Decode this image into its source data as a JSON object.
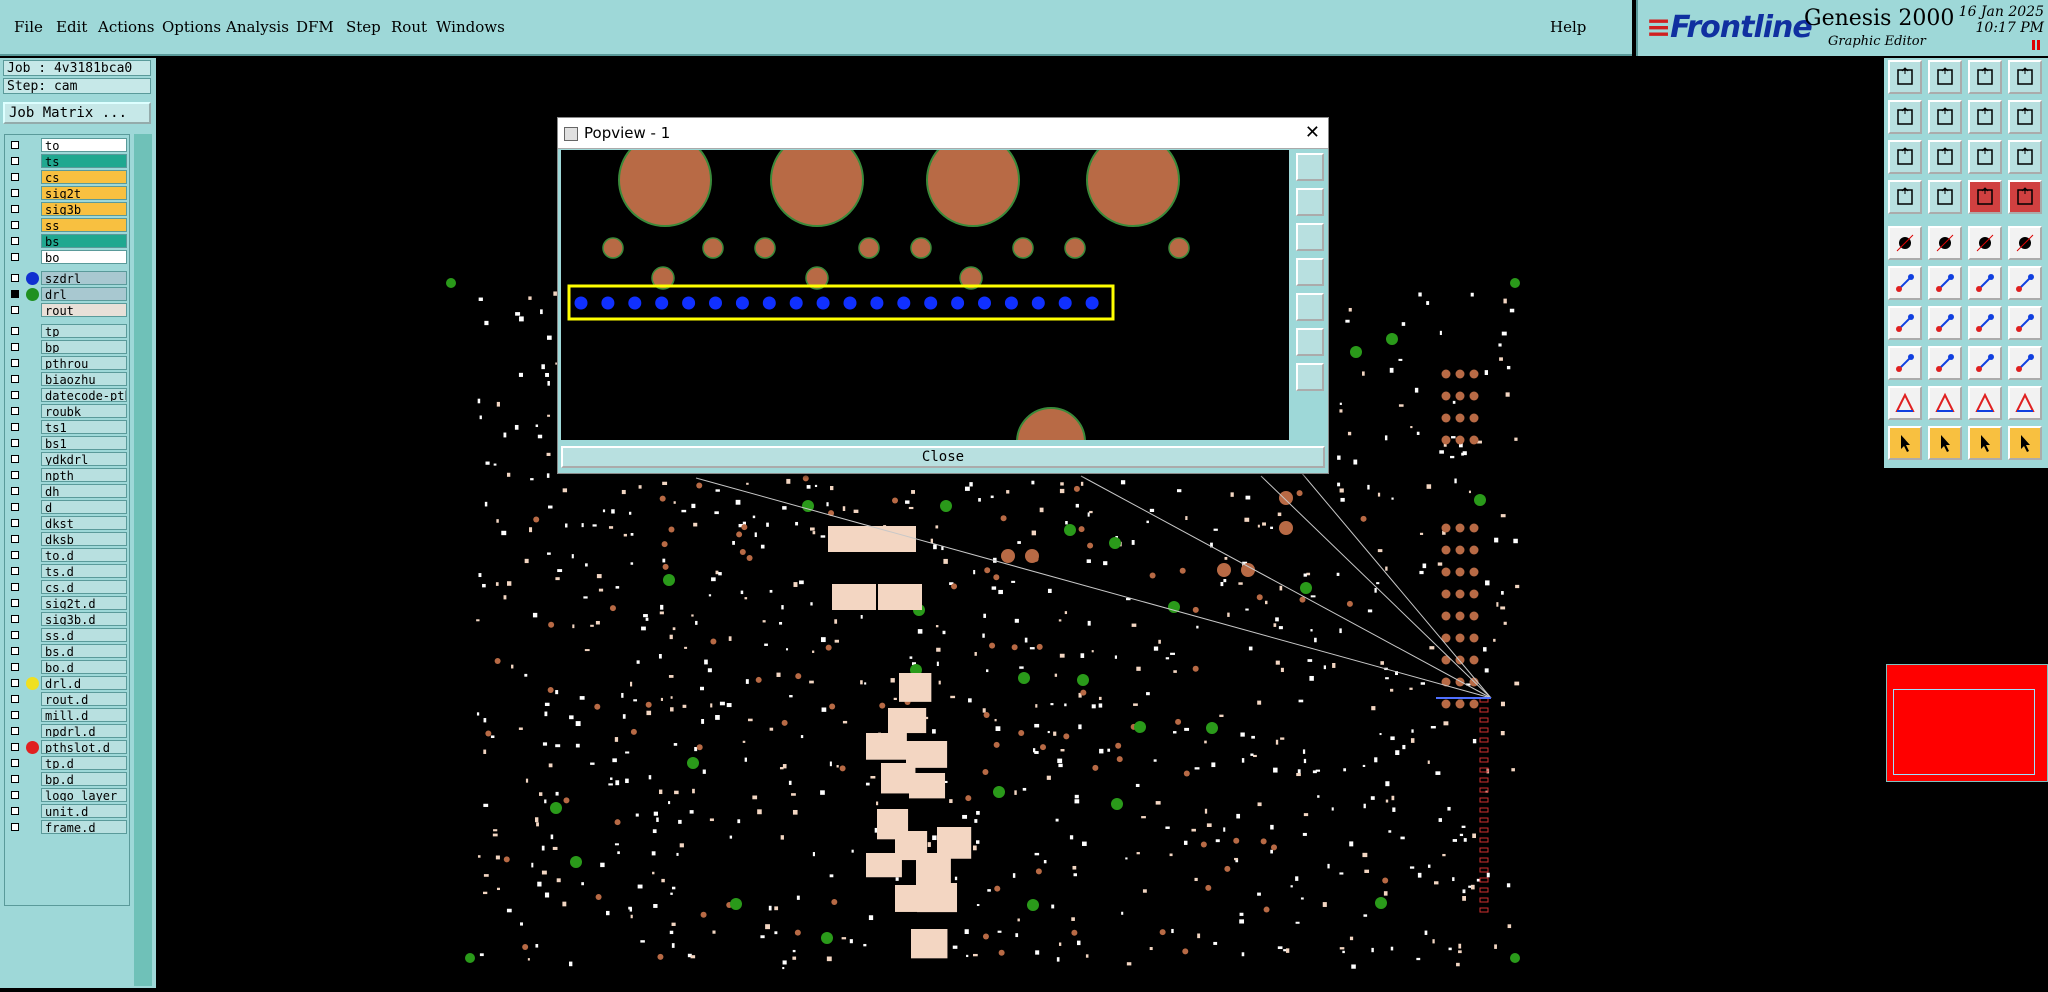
{
  "menu": {
    "items": [
      {
        "label": "File",
        "u": "F"
      },
      {
        "label": "Edit",
        "u": "E"
      },
      {
        "label": "Actions",
        "u": "A"
      },
      {
        "label": "Options",
        "u": "O"
      },
      {
        "label": "Analysis",
        "u": "A"
      },
      {
        "label": "DFM",
        "u": "D"
      },
      {
        "label": "Step",
        "u": "S"
      },
      {
        "label": "Rout",
        "u": "R"
      },
      {
        "label": "Windows",
        "u": "W"
      }
    ],
    "help": "Help"
  },
  "brand": {
    "logo": "Frontline",
    "product": "Genesis 2000",
    "subtitle": "Graphic Editor",
    "date": "16 Jan 2025",
    "time": "10:17 PM"
  },
  "job": {
    "job_label": "Job : 4v3181bca0",
    "step_label": "Step: cam",
    "matrix_button": "Job Matrix ..."
  },
  "layers": [
    {
      "name": "to",
      "bg": "#ffffff"
    },
    {
      "name": "ts",
      "bg": "#20a890"
    },
    {
      "name": "cs",
      "bg": "#f8c040"
    },
    {
      "name": "sig2t",
      "bg": "#f8c040"
    },
    {
      "name": "sig3b",
      "bg": "#f8c040"
    },
    {
      "name": "ss",
      "bg": "#f8c040"
    },
    {
      "name": "bs",
      "bg": "#20a890"
    },
    {
      "name": "bo",
      "bg": "#ffffff"
    },
    {
      "name": "szdrl",
      "bg": "#a8c8d0",
      "dot": "#1030d0",
      "gap": true
    },
    {
      "name": "drl",
      "bg": "#a8c8d0",
      "dot": "#209020",
      "checked": true
    },
    {
      "name": "rout",
      "bg": "#e8e0d8"
    },
    {
      "name": "tp",
      "bg": "#b8e0e0",
      "gap": true
    },
    {
      "name": "bp",
      "bg": "#b8e0e0"
    },
    {
      "name": "pthrou",
      "bg": "#b8e0e0"
    },
    {
      "name": "biaozhu",
      "bg": "#b8e0e0"
    },
    {
      "name": "datecode-pth",
      "bg": "#b8e0e0"
    },
    {
      "name": "roubk",
      "bg": "#b8e0e0"
    },
    {
      "name": "ts1",
      "bg": "#b8e0e0"
    },
    {
      "name": "bs1",
      "bg": "#b8e0e0"
    },
    {
      "name": "ydkdrl",
      "bg": "#b8e0e0"
    },
    {
      "name": "npth",
      "bg": "#b8e0e0"
    },
    {
      "name": "dh",
      "bg": "#b8e0e0"
    },
    {
      "name": "d",
      "bg": "#b8e0e0"
    },
    {
      "name": "dkst",
      "bg": "#b8e0e0"
    },
    {
      "name": "dksb",
      "bg": "#b8e0e0"
    },
    {
      "name": "to.d",
      "bg": "#b8e0e0"
    },
    {
      "name": "ts.d",
      "bg": "#b8e0e0"
    },
    {
      "name": "cs.d",
      "bg": "#b8e0e0"
    },
    {
      "name": "sig2t.d",
      "bg": "#b8e0e0"
    },
    {
      "name": "sig3b.d",
      "bg": "#b8e0e0"
    },
    {
      "name": "ss.d",
      "bg": "#b8e0e0"
    },
    {
      "name": "bs.d",
      "bg": "#b8e0e0"
    },
    {
      "name": "bo.d",
      "bg": "#b8e0e0"
    },
    {
      "name": "drl.d",
      "bg": "#b8e0e0",
      "dot": "#f0e020"
    },
    {
      "name": "rout.d",
      "bg": "#b8e0e0"
    },
    {
      "name": "mill.d",
      "bg": "#b8e0e0"
    },
    {
      "name": "npdrl.d",
      "bg": "#b8e0e0"
    },
    {
      "name": "pthslot.d",
      "bg": "#b8e0e0",
      "dot": "#e02020"
    },
    {
      "name": "tp.d",
      "bg": "#b8e0e0"
    },
    {
      "name": "bp.d",
      "bg": "#b8e0e0"
    },
    {
      "name": "logo_layer_",
      "bg": "#b8e0e0"
    },
    {
      "name": "unit.d",
      "bg": "#b8e0e0"
    },
    {
      "name": "frame.d",
      "bg": "#b8e0e0"
    }
  ],
  "popview": {
    "title": "Popview - 1",
    "close_button": "Close",
    "highlight_color": "#ffff00",
    "drill_color": "#1030ff",
    "pad_color": "#b86a45"
  },
  "toolbox": {
    "buttons": [
      "open-job-icon",
      "save-icon",
      "home-icon",
      "layout-icon",
      "zoom-back-icon",
      "zoom-forward-icon",
      "undo-zoom-icon",
      "window-split-icon",
      "fit-icon",
      "center-icon",
      "scale-1to2-icon",
      "help-icon",
      "measure-icon",
      "probe-icon",
      "snap-icon",
      "graph-icon",
      "single-select-icon",
      "line-icon",
      "strip-icon",
      "circle-icon",
      "move-icon",
      "cross-icon",
      "connect-icon",
      "link-icon",
      "angle-icon",
      "diagonal-icon",
      "arc-icon",
      "gap-icon",
      "pad-icon",
      "cut-icon",
      "resize-icon",
      "group-icon",
      "text-a-icon",
      "text-b-icon",
      "text-c-icon",
      "text-d-icon",
      "pointer-icon",
      "pointer-select-icon",
      "pointer-circle-icon",
      "pointer-step-icon"
    ]
  }
}
